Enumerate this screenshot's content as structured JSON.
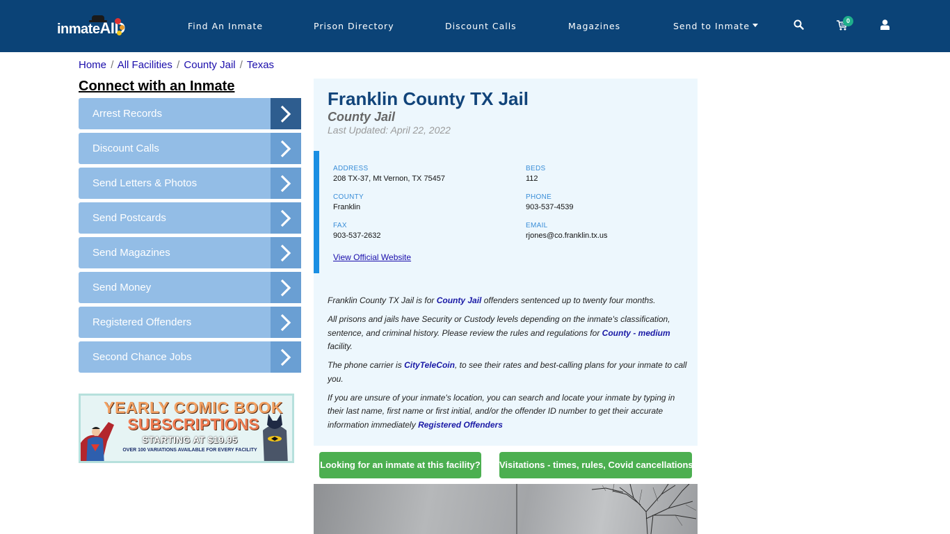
{
  "navbar": {
    "logo": {
      "text_main": "inmate",
      "text_accent": "AID"
    },
    "items": [
      {
        "label": "Find An Inmate"
      },
      {
        "label": "Prison Directory"
      },
      {
        "label": "Discount Calls"
      },
      {
        "label": "Magazines"
      },
      {
        "label": "Send to Inmate",
        "has_dropdown": true
      }
    ],
    "icons": [
      "search-icon",
      "cart-icon",
      "user-icon"
    ],
    "cart_count": "0",
    "colors": {
      "background": "#0b4377",
      "badge": "#1fae8b"
    }
  },
  "breadcrumb": [
    {
      "label": "Home"
    },
    {
      "label": "All Facilities"
    },
    {
      "label": "County Jail"
    },
    {
      "label": "Texas"
    }
  ],
  "breadcrumb_separator": "/",
  "sidebar": {
    "title": "Connect with an Inmate",
    "items": [
      {
        "label": "Arrest Records",
        "active": true
      },
      {
        "label": "Discount Calls"
      },
      {
        "label": "Send Letters & Photos"
      },
      {
        "label": "Send Postcards"
      },
      {
        "label": "Send Magazines"
      },
      {
        "label": "Send Money"
      },
      {
        "label": "Registered Offenders"
      },
      {
        "label": "Second Chance Jobs"
      }
    ],
    "ad": {
      "line1": "YEARLY COMIC BOOK",
      "line2": "SUBSCRIPTIONS",
      "line3": "STARTING AT $19.95",
      "line4": "OVER 100 VARIATIONS AVAILABLE FOR EVERY FACILITY"
    }
  },
  "facility": {
    "title": "Franklin County TX Jail",
    "type": "County Jail",
    "last_updated": "Last Updated: April 22, 2022",
    "info": {
      "address_label": "ADDRESS",
      "address": "208 TX-37, Mt Vernon, TX 75457",
      "beds_label": "BEDS",
      "beds": "112",
      "county_label": "COUNTY",
      "county": "Franklin",
      "phone_label": "PHONE",
      "phone": "903-537-4539",
      "fax_label": "FAX",
      "fax": "903-537-2632",
      "email_label": "EMAIL",
      "email": "rjones@co.franklin.tx.us",
      "website_link": "View Official Website"
    },
    "description": {
      "p1_pre": "Franklin County TX Jail is for ",
      "p1_link": "County Jail",
      "p1_post": " offenders sentenced up to twenty four months.",
      "p2_pre": "All prisons and jails have Security or Custody levels depending on the inmate's classification, sentence, and criminal history. Please review the rules and regulations for ",
      "p2_link": "County - medium",
      "p2_post": " facility.",
      "p3_pre": "The phone carrier is ",
      "p3_link": "CityTeleCoin",
      "p3_post": ", to see their rates and best-calling plans for your inmate to call you.",
      "p4_pre": "If you are unsure of your inmate's location, you can search and locate your inmate by typing in their last name, first name or first initial, and/or the offender ID number to get their accurate information immediately ",
      "p4_link": "Registered Offenders"
    }
  },
  "buttons": {
    "find_inmate": "Looking for an inmate at this facility?",
    "visitations": "Visitations - times, rules, Covid cancellations",
    "color": "#4caf50"
  }
}
